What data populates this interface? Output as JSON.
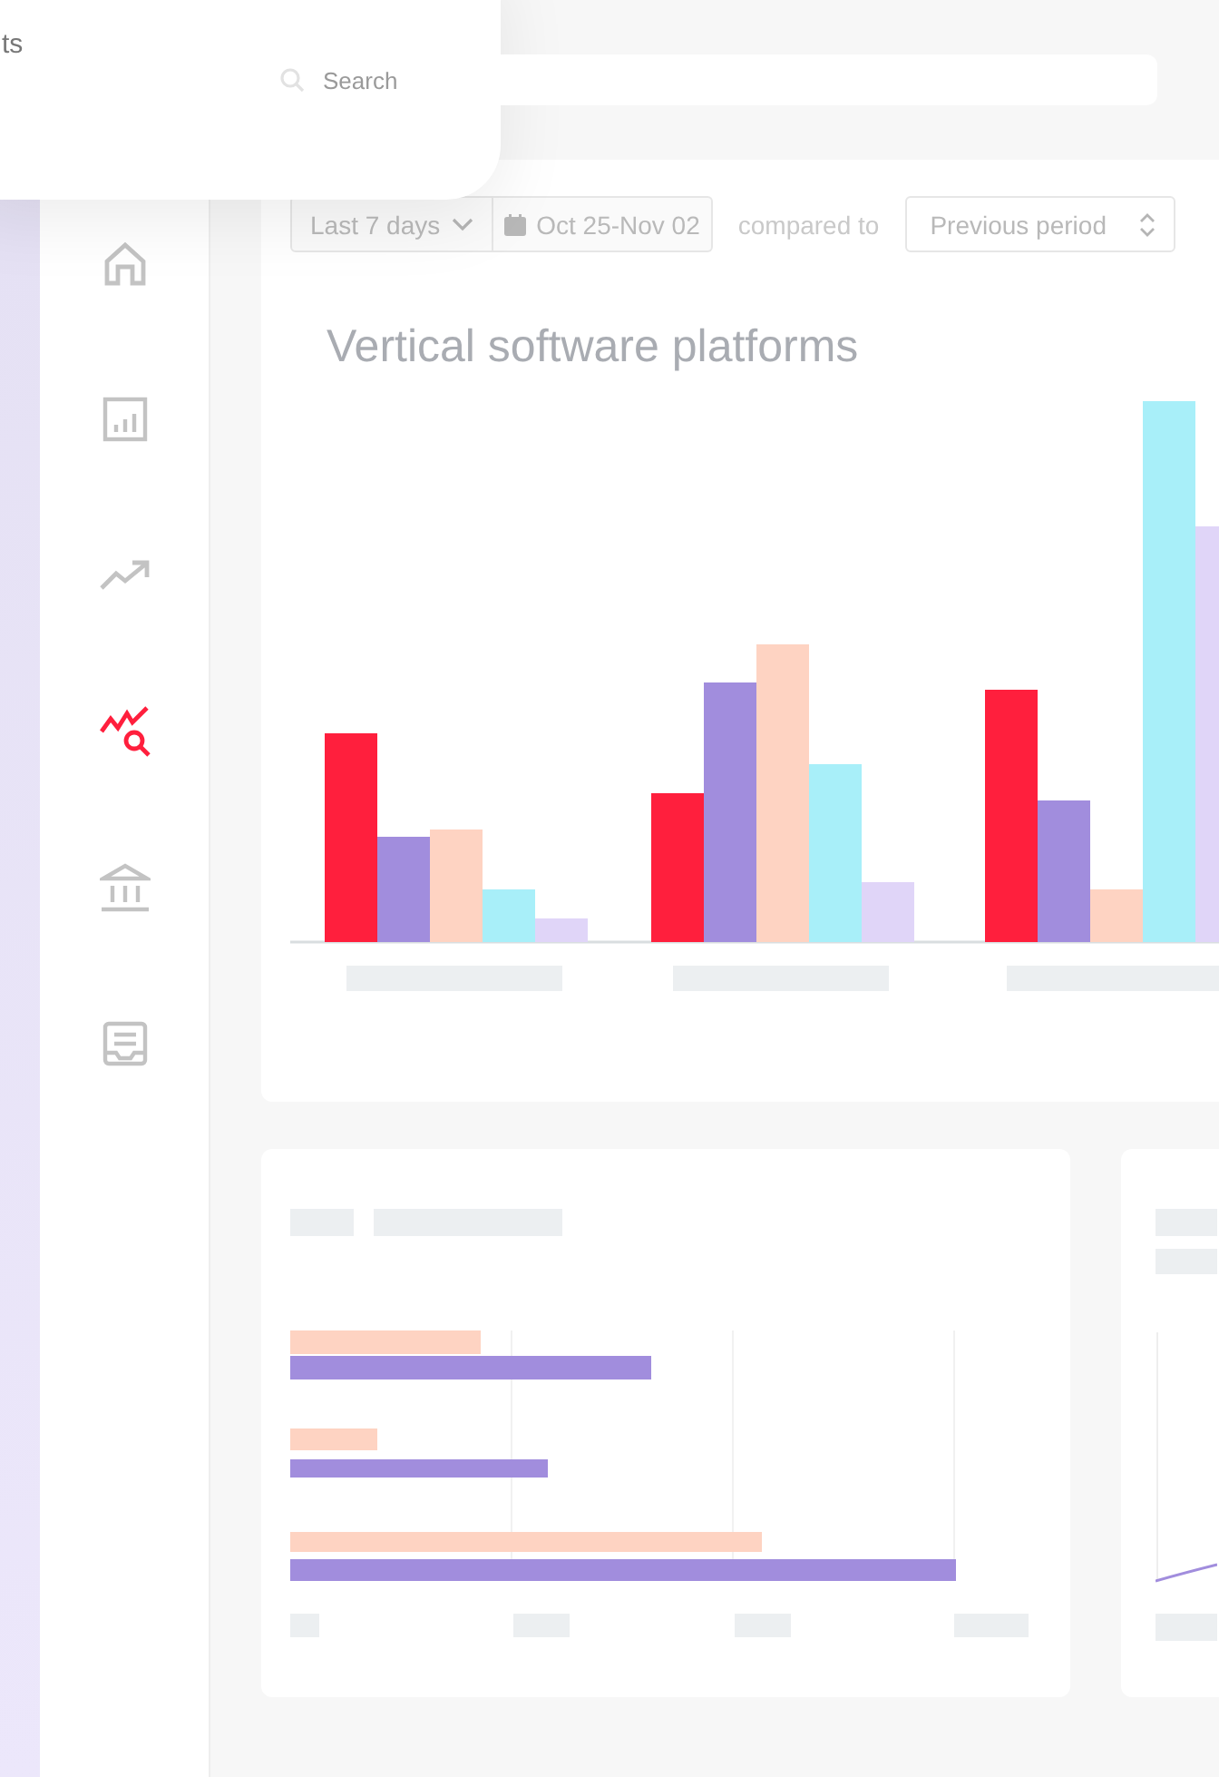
{
  "popover": {
    "text": "ts"
  },
  "search": {
    "placeholder": "Search"
  },
  "sidebar": {
    "items": [
      {
        "kind": "home",
        "selected": false
      },
      {
        "kind": "report",
        "selected": false
      },
      {
        "kind": "trend",
        "selected": false
      },
      {
        "kind": "analysis",
        "selected": true
      },
      {
        "kind": "bank",
        "selected": false
      },
      {
        "kind": "inbox",
        "selected": false
      }
    ]
  },
  "filters": {
    "range": "Last 7 days",
    "dates": "Oct 25-Nov 02",
    "compare_label": "compared to",
    "compare": "Previous period"
  },
  "main_chart": {
    "title": "Vertical software platforms"
  }
}
